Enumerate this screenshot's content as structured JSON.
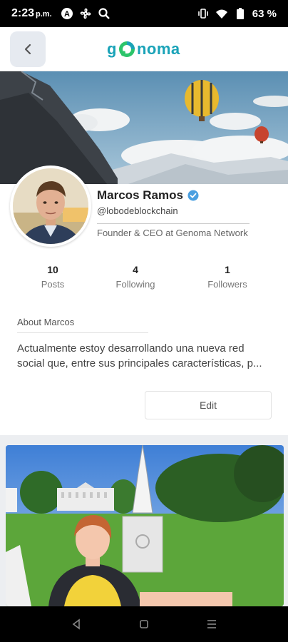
{
  "status_bar": {
    "time": "2:23",
    "ampm": "p.m.",
    "battery": "63 %",
    "icons": [
      "a-icon",
      "fan-icon",
      "search-icon",
      "vibrate-icon",
      "wifi-icon",
      "battery-icon"
    ]
  },
  "header": {
    "back_icon": "chevron-left-icon",
    "logo_text_before": "g",
    "logo_text_after": "noma"
  },
  "profile": {
    "name": "Marcos Ramos",
    "handle": "@lobodeblockchain",
    "title": "Founder & CEO at Genoma Network",
    "verified": true
  },
  "stats": [
    {
      "value": "10",
      "label": "Posts"
    },
    {
      "value": "4",
      "label": "Following"
    },
    {
      "value": "1",
      "label": "Followers"
    }
  ],
  "about": {
    "title": "About Marcos",
    "line1": "Actualmente estoy desarrollando una nueva red",
    "line2": "social que, entre sus principales características, p..."
  },
  "edit_label": "Edit",
  "colors": {
    "brand": "#1aa3b8",
    "verified": "#4a9fe0",
    "back_bg": "#e6eaf0"
  },
  "nav": [
    "back-triangle-icon",
    "home-square-icon",
    "menu-lines-icon"
  ]
}
